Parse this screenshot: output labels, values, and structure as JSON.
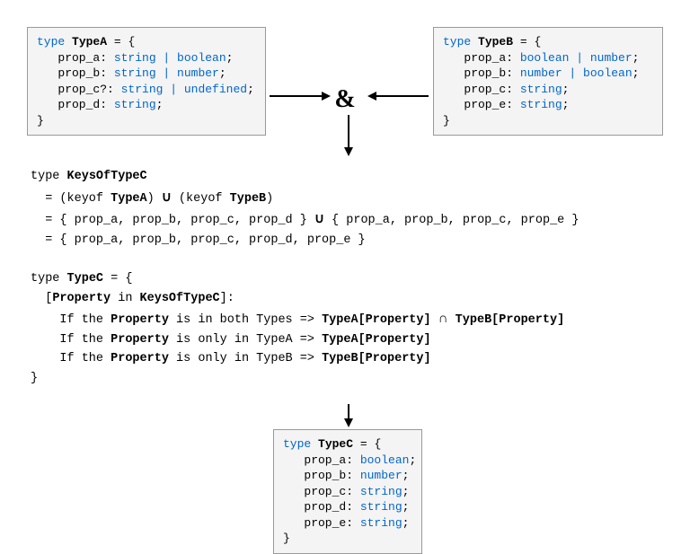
{
  "boxA": {
    "head_kw": "type",
    "head_name": "TypeA",
    "head_tail": " = {",
    "lines": [
      {
        "prop": "prop_a",
        "type": "string | boolean"
      },
      {
        "prop": "prop_b",
        "type": "string | number"
      },
      {
        "prop": "prop_c?",
        "type": "string | undefined"
      },
      {
        "prop": "prop_d",
        "type": "string"
      }
    ],
    "close": "}"
  },
  "boxB": {
    "head_kw": "type",
    "head_name": "TypeB",
    "head_tail": " = {",
    "lines": [
      {
        "prop": "prop_a",
        "type": "boolean | number"
      },
      {
        "prop": "prop_b",
        "type": "number | boolean"
      },
      {
        "prop": "prop_c",
        "type": "string"
      },
      {
        "prop": "prop_e",
        "type": "string"
      }
    ],
    "close": "}"
  },
  "boxC": {
    "head_kw": "type",
    "head_name": "TypeC",
    "head_tail": " = {",
    "lines": [
      {
        "prop": "prop_a",
        "type": "boolean"
      },
      {
        "prop": "prop_b",
        "type": "number"
      },
      {
        "prop": "prop_c",
        "type": "string"
      },
      {
        "prop": "prop_d",
        "type": "string"
      },
      {
        "prop": "prop_e",
        "type": "string"
      }
    ],
    "close": "}"
  },
  "amp": "&",
  "explain": {
    "l1a": "type ",
    "l1b": "KeysOfTypeC",
    "l2a": "  = (keyof ",
    "l2b": "TypeA",
    "l2c": ") ",
    "l2u": "∪",
    "l2d": " (keyof ",
    "l2e": "TypeB",
    "l2f": ")",
    "l3a": "  = { prop_a, prop_b, prop_c, prop_d } ",
    "l3u": "∪",
    "l3b": " { prop_a, prop_b, prop_c, prop_e }",
    "l4": "  = { prop_a, prop_b, prop_c, prop_d, prop_e }",
    "blank": "",
    "l5a": "type ",
    "l5b": "TypeC",
    "l5c": " = {",
    "l6a": "  [",
    "l6b": "Property",
    "l6c": " in ",
    "l6d": "KeysOfTypeC",
    "l6e": "]:",
    "l7a": "    If the ",
    "l7b": "Property",
    "l7c": " is in both Types => ",
    "l7d": "TypeA[Property]",
    "l7e": " ",
    "l7op": "∩",
    "l7f": " ",
    "l7g": "TypeB[Property]",
    "l8a": "    If the ",
    "l8b": "Property",
    "l8c": " is only in TypeA => ",
    "l8d": "TypeA[Property]",
    "l9a": "    If the ",
    "l9b": "Property",
    "l9c": " is only in TypeB => ",
    "l9d": "TypeB[Property]",
    "l10": "}"
  }
}
